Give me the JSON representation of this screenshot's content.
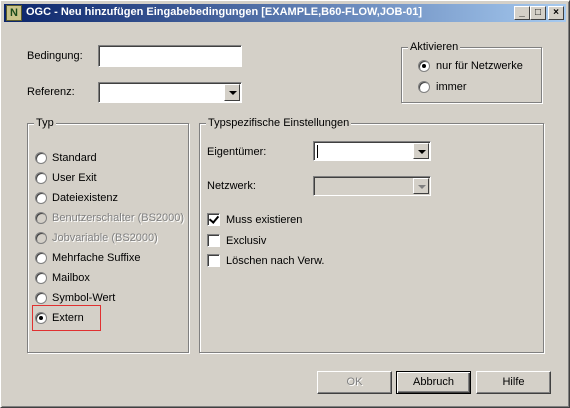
{
  "window": {
    "title": "OGC - Neu hinzufügen Eingabebedingungen [EXAMPLE,B60-FLOW,JOB-01]",
    "icon": "N",
    "minimize_glyph": "_",
    "maximize_glyph": "□",
    "close_glyph": "×"
  },
  "form": {
    "bedingung_label": "Bedingung:",
    "bedingung_value": "",
    "referenz_label": "Referenz:",
    "referenz_value": ""
  },
  "aktivieren": {
    "title": "Aktivieren",
    "options": [
      {
        "label": "nur für Netzwerke",
        "selected": true
      },
      {
        "label": "immer",
        "selected": false
      }
    ]
  },
  "typ": {
    "title": "Typ",
    "options": [
      {
        "label": "Standard",
        "selected": false,
        "enabled": true
      },
      {
        "label": "User Exit",
        "selected": false,
        "enabled": true
      },
      {
        "label": "Dateiexistenz",
        "selected": false,
        "enabled": true
      },
      {
        "label": "Benutzerschalter (BS2000)",
        "selected": false,
        "enabled": false
      },
      {
        "label": "Jobvariable (BS2000)",
        "selected": false,
        "enabled": false
      },
      {
        "label": "Mehrfache Suffixe",
        "selected": false,
        "enabled": true
      },
      {
        "label": "Mailbox",
        "selected": false,
        "enabled": true
      },
      {
        "label": "Symbol-Wert",
        "selected": false,
        "enabled": true
      },
      {
        "label": "Extern",
        "selected": true,
        "enabled": true
      }
    ]
  },
  "typspez": {
    "title": "Typspezifische Einstellungen",
    "eigentuemer_label": "Eigentümer:",
    "eigentuemer_value": "",
    "netzwerk_label": "Netzwerk:",
    "netzwerk_value": "",
    "checks": [
      {
        "label": "Muss existieren",
        "checked": true
      },
      {
        "label": "Exclusiv",
        "checked": false
      },
      {
        "label": "Löschen nach Verw.",
        "checked": false
      }
    ]
  },
  "buttons": {
    "ok": "OK",
    "abbruch": "Abbruch",
    "hilfe": "Hilfe"
  },
  "colors": {
    "face": "#d4d0c8",
    "title_start": "#0a246a",
    "title_end": "#a6caf0",
    "focus": "#e03030"
  }
}
